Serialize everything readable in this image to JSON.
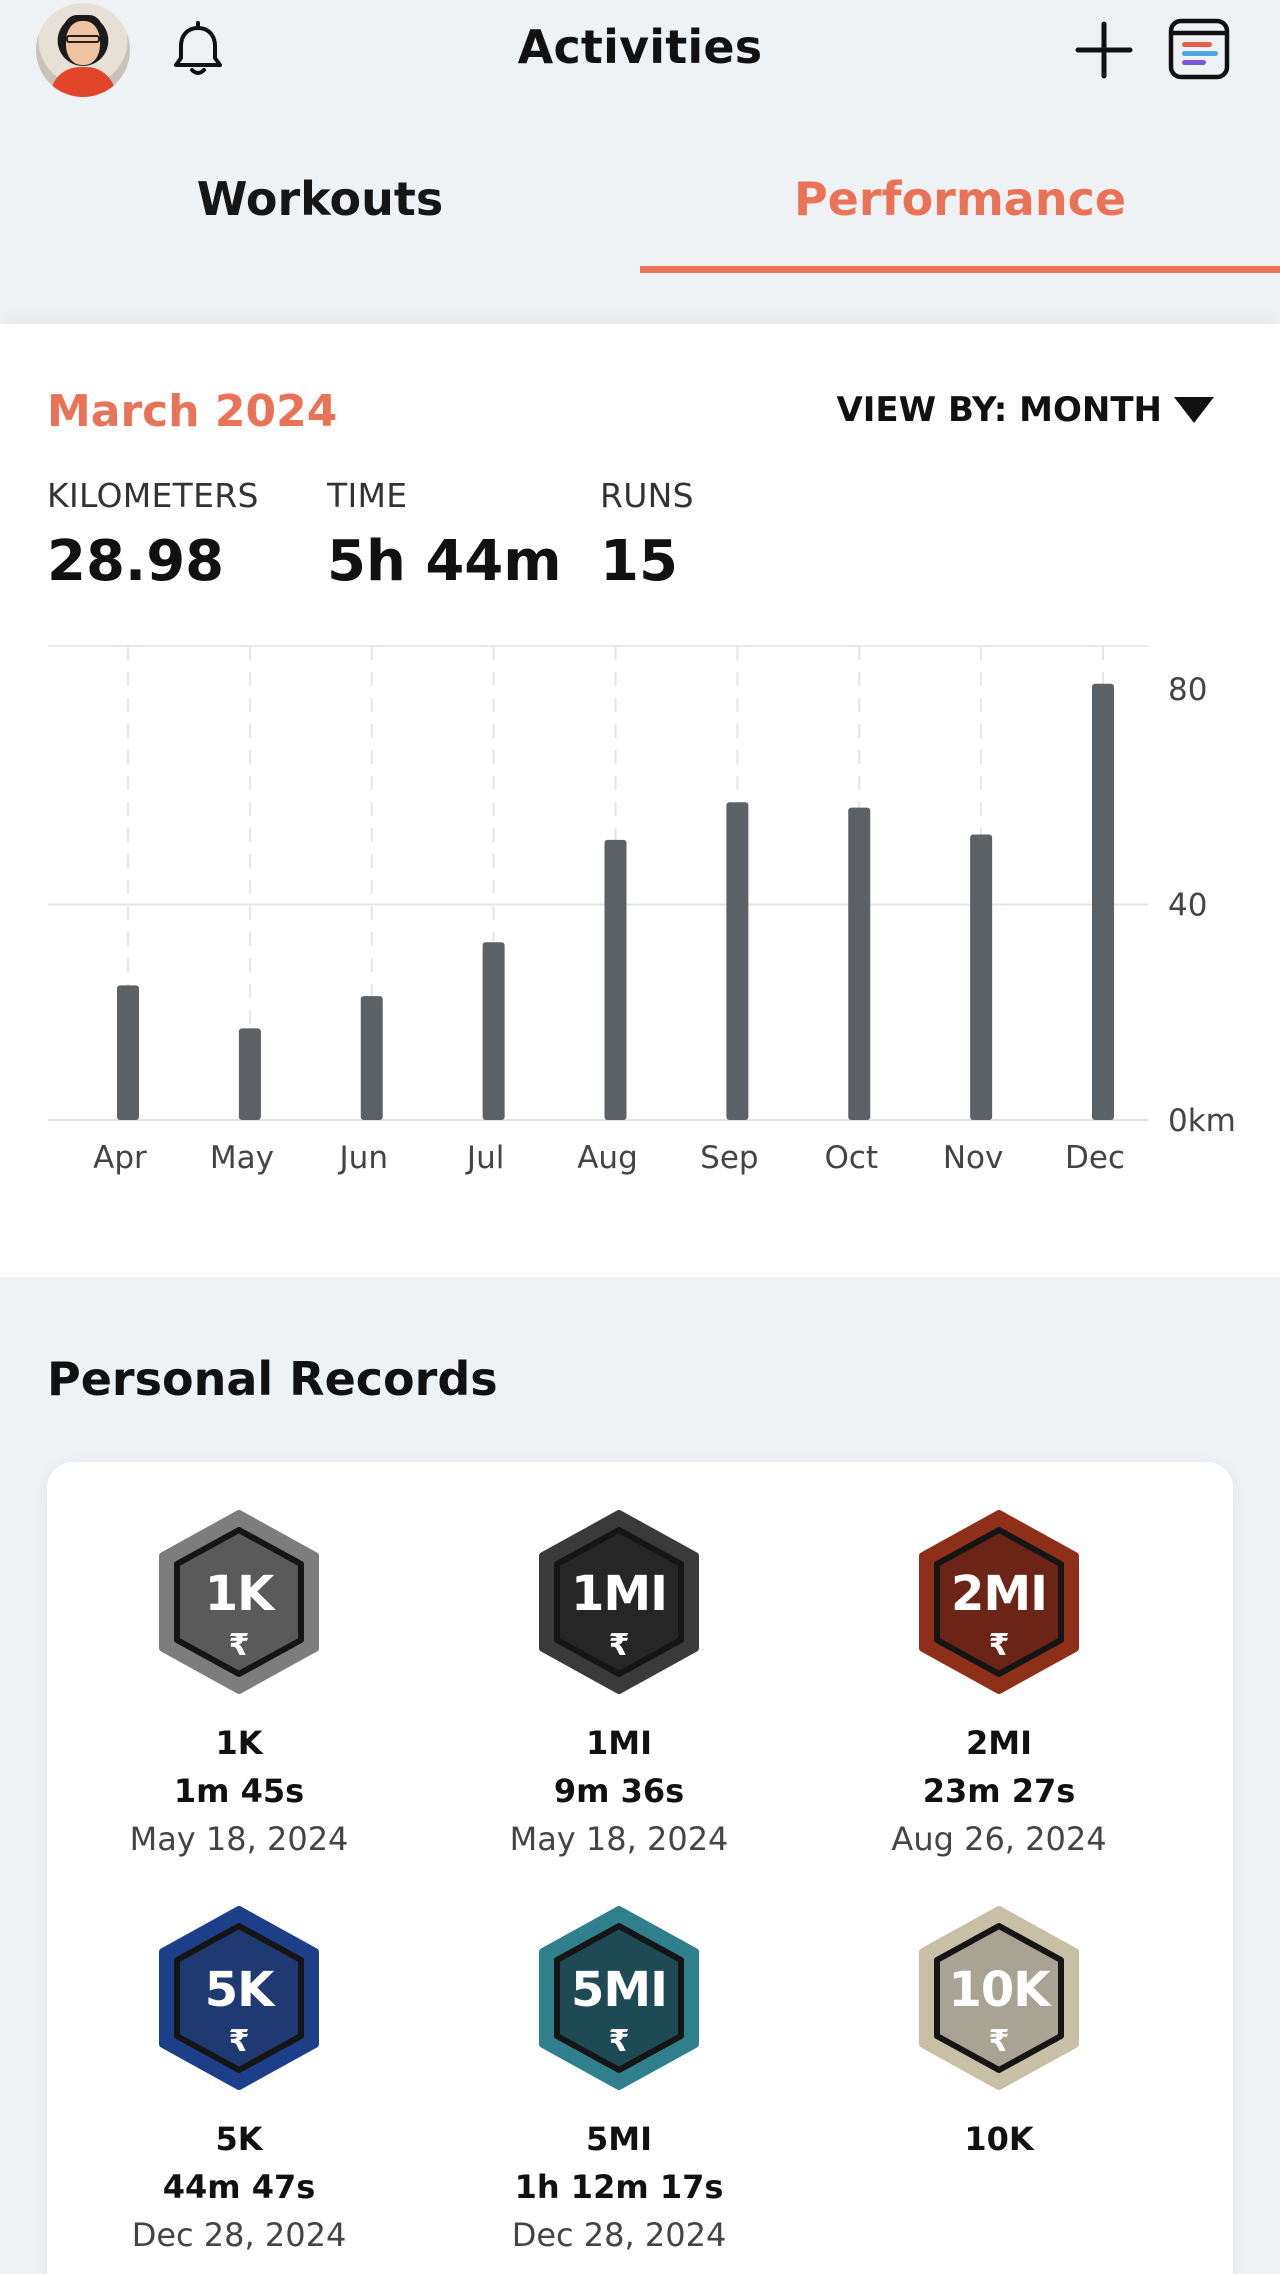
{
  "header": {
    "title": "Activities",
    "icons": [
      "avatar",
      "bell-icon",
      "plus-icon",
      "calendar-icon"
    ]
  },
  "tabs": [
    {
      "label": "Workouts",
      "active": false
    },
    {
      "label": "Performance",
      "active": true
    }
  ],
  "summary": {
    "period": "March 2024",
    "view_by": "VIEW BY: MONTH",
    "stats": [
      {
        "label": "KILOMETERS",
        "value": "28.98"
      },
      {
        "label": "TIME",
        "value": "5h 44m"
      },
      {
        "label": "RUNS",
        "value": "15"
      }
    ]
  },
  "chart_data": {
    "type": "bar",
    "categories": [
      "Apr",
      "May",
      "Jun",
      "Jul",
      "Aug",
      "Sep",
      "Oct",
      "Nov",
      "Dec"
    ],
    "values": [
      25,
      17,
      23,
      33,
      52,
      59,
      58,
      53,
      81
    ],
    "y_ticks": [
      "0km",
      "40",
      "80"
    ],
    "ylim": [
      0,
      88
    ],
    "grid": true,
    "bar_color": "#5c6166"
  },
  "records": {
    "title": "Personal Records",
    "items": [
      {
        "badge": "1K",
        "name": "1K",
        "time": "1m 45s",
        "date": "May 18, 2024",
        "color": "#5a5a5a",
        "ring": "#7d7d7d"
      },
      {
        "badge": "1MI",
        "name": "1MI",
        "time": "9m 36s",
        "date": "May 18, 2024",
        "color": "#262626",
        "ring": "#3a3a3a"
      },
      {
        "badge": "2MI",
        "name": "2MI",
        "time": "23m 27s",
        "date": "Aug 26, 2024",
        "color": "#6b2416",
        "ring": "#8e2f19"
      },
      {
        "badge": "5K",
        "name": "5K",
        "time": "44m 47s",
        "date": "Dec 28, 2024",
        "color": "#1f3a72",
        "ring": "#1d3f8a"
      },
      {
        "badge": "5MI",
        "name": "5MI",
        "time": "1h 12m 17s",
        "date": "Dec 28, 2024",
        "color": "#1d4a55",
        "ring": "#2f7f8c"
      },
      {
        "badge": "10K",
        "name": "10K",
        "time": "",
        "date": "",
        "color": "#a9a394",
        "ring": "#c7c0a6"
      }
    ]
  },
  "runner_glyph": "₹",
  "accent_color": "#ea7257"
}
